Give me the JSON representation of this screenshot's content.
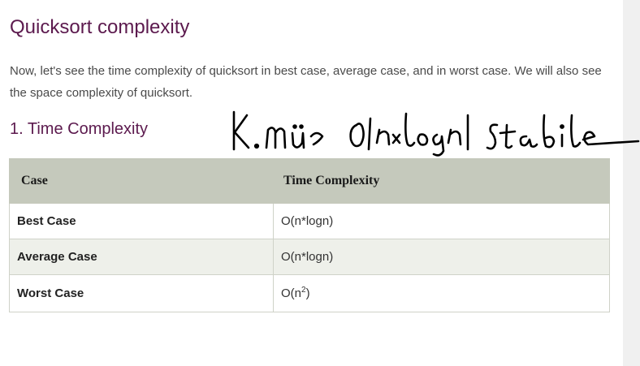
{
  "article": {
    "title": "Quicksort complexity",
    "intro": "Now, let's see the time complexity of quicksort in best case, average case, and in worst case. We will also see the space complexity of quicksort.",
    "section_heading": "1. Time Complexity",
    "handwritten_note": "K.min O(n×logn) stabil"
  },
  "table": {
    "headers": [
      "Case",
      "Time Complexity"
    ],
    "rows": [
      {
        "case": "Best Case",
        "complexity": "O(n*logn)"
      },
      {
        "case": "Average Case",
        "complexity": "O(n*logn)"
      },
      {
        "case": "Worst Case",
        "complexity_base": "O(n",
        "complexity_exp": "2",
        "complexity_close": ")"
      }
    ]
  },
  "colors": {
    "heading": "#5c1a4e",
    "table_header_bg": "#c5c9bc",
    "alt_row_bg": "#eef0ea",
    "ink": "#000000"
  }
}
